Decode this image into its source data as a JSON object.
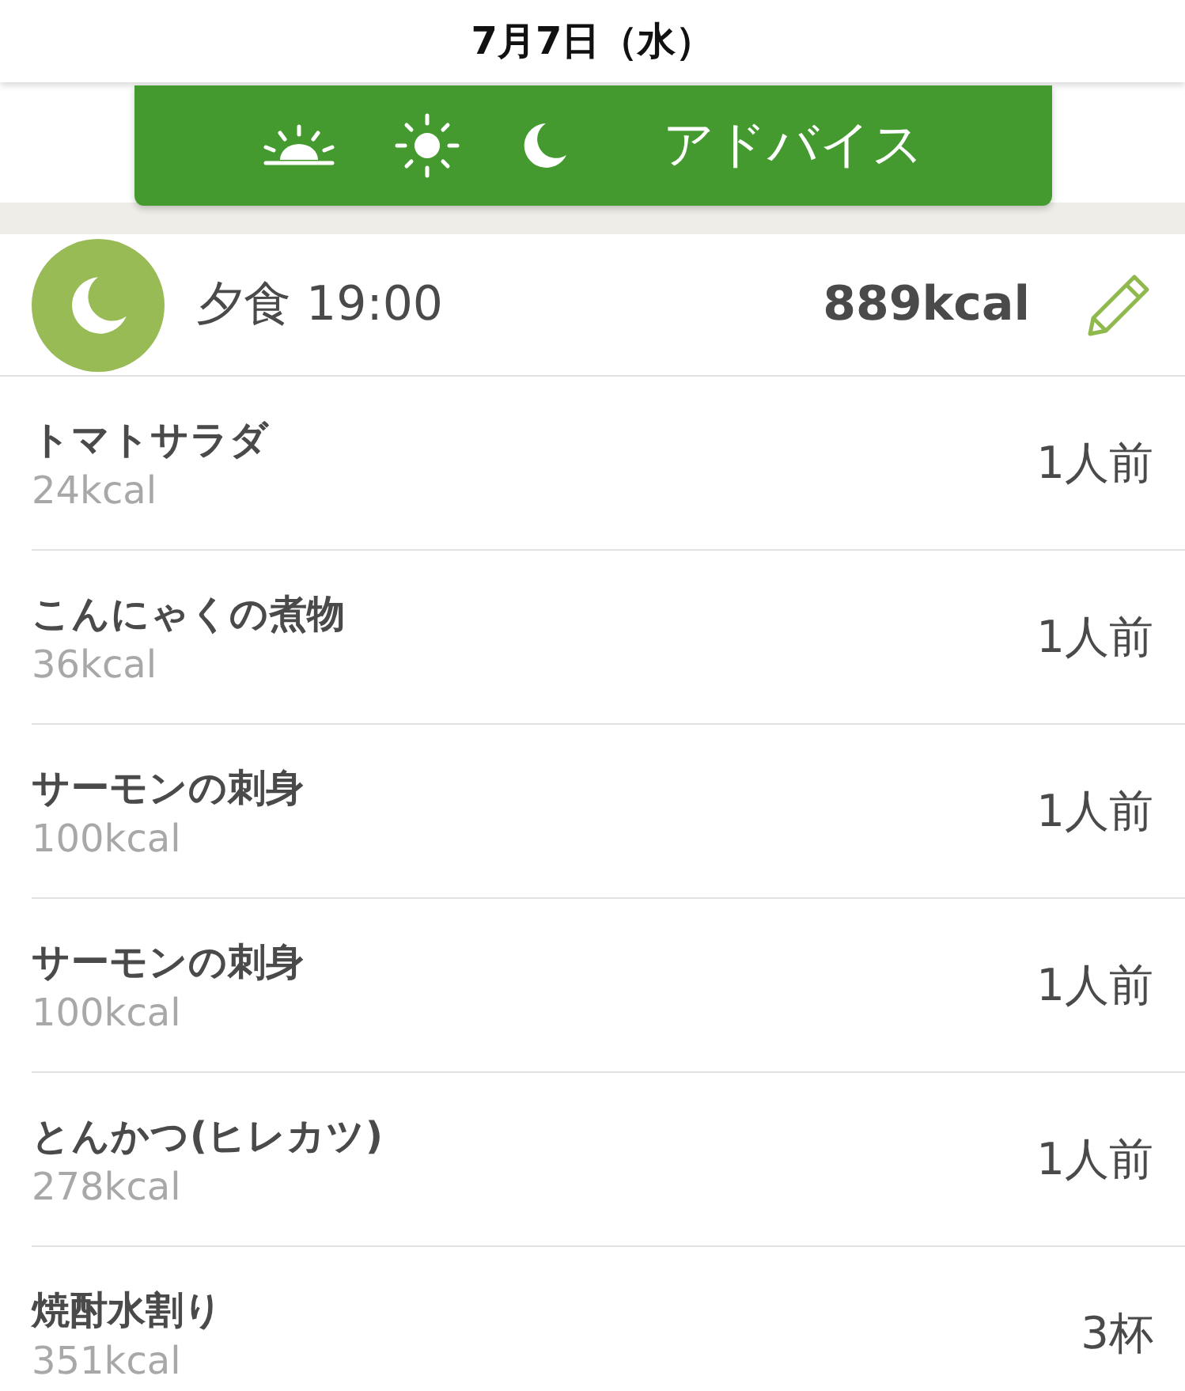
{
  "header": {
    "title": "7月7日（水）"
  },
  "toolbar": {
    "advice": "アドバイス"
  },
  "meal": {
    "title": "夕食 19:00",
    "total": "889kcal"
  },
  "items": [
    {
      "name": "トマトサラダ",
      "kcal": "24kcal",
      "amount": "1人前"
    },
    {
      "name": "こんにゃくの煮物",
      "kcal": "36kcal",
      "amount": "1人前"
    },
    {
      "name": "サーモンの刺身",
      "kcal": "100kcal",
      "amount": "1人前"
    },
    {
      "name": "サーモンの刺身",
      "kcal": "100kcal",
      "amount": "1人前"
    },
    {
      "name": "とんかつ(ヒレカツ)",
      "kcal": "278kcal",
      "amount": "1人前"
    },
    {
      "name": "焼酎水割り",
      "kcal": "351kcal",
      "amount": "3杯"
    }
  ]
}
